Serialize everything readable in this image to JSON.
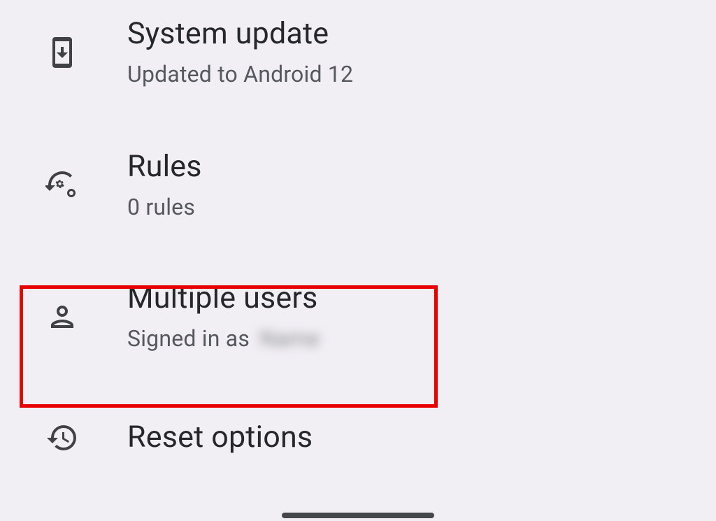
{
  "items": {
    "system_update": {
      "title": "System update",
      "subtitle": "Updated to Android 12"
    },
    "rules": {
      "title": "Rules",
      "subtitle": "0 rules"
    },
    "multiple_users": {
      "title": "Multiple users",
      "subtitle_prefix": "Signed in as",
      "subtitle_name": "Name"
    },
    "reset_options": {
      "title": "Reset options"
    }
  }
}
